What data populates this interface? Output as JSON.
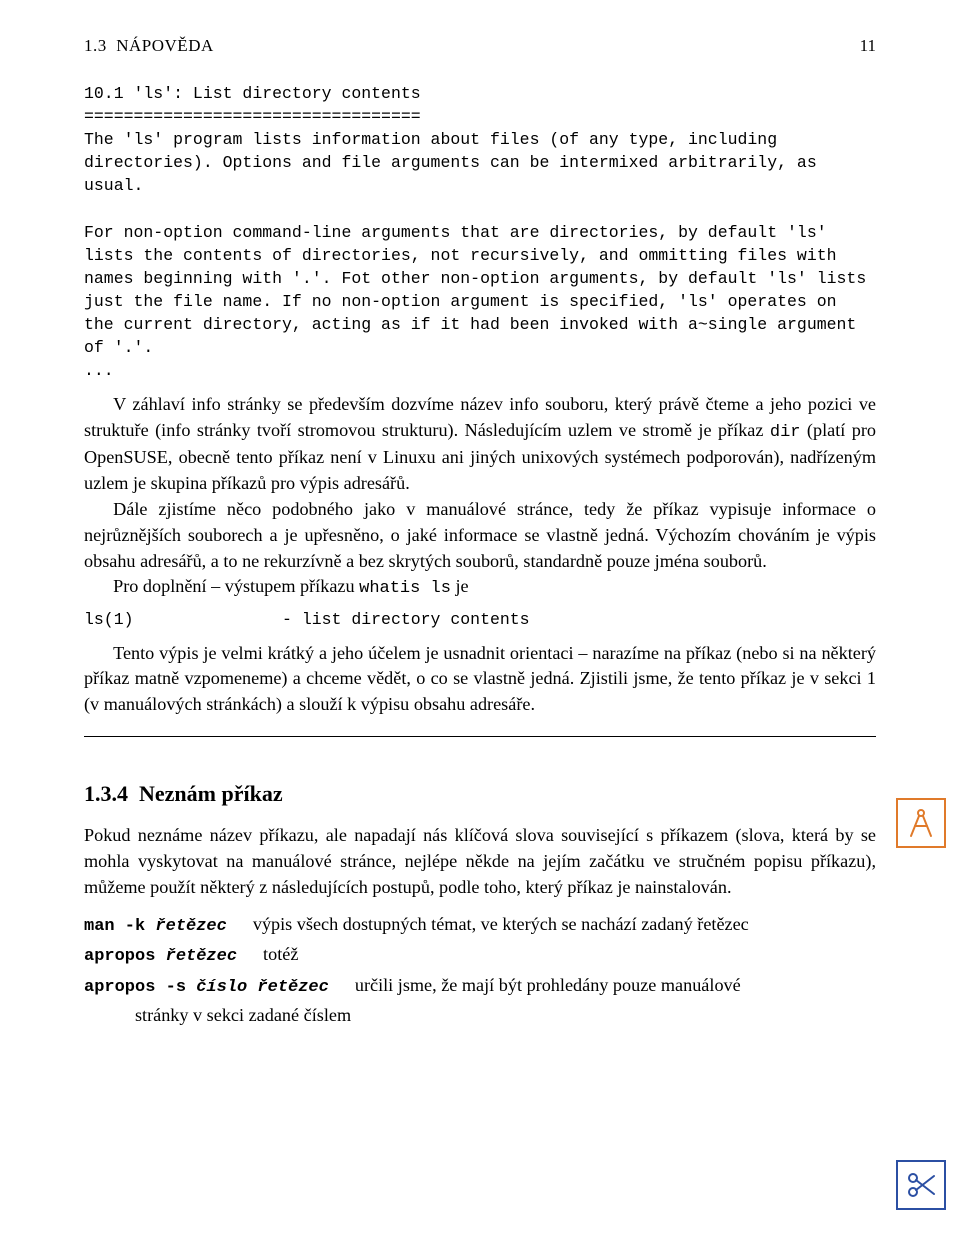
{
  "header": {
    "section_number": "1.3",
    "section_title_caps": "NÁPOVĚDA",
    "page_number": "11"
  },
  "mono_block": "10.1 'ls': List directory contents\n==================================\nThe 'ls' program lists information about files (of any type, including directories). Options and file arguments can be intermixed arbitrarily, as usual.\n\nFor non-option command-line arguments that are directories, by default 'ls' lists the contents of directories, not recursively, and ommitting files with names beginning with '.'. Fot other non-option arguments, by default 'ls' lists just the file name. If no non-option argument is specified, 'ls' operates on the current directory, acting as if it had been invoked with a~single argument of '.'.\n...",
  "para1_a": "V záhlaví info stránky se především dozvíme název info souboru, který právě čteme a jeho pozici ve struktuře (info stránky tvoří stromovou strukturu). Následujícím uzlem ve stromě je příkaz ",
  "para1_mono": "dir",
  "para1_b": " (platí pro OpenSUSE, obecně tento příkaz není v Linuxu ani jiných unixových systémech podporován), nadřízeným uzlem je skupina příkazů pro výpis adresářů.",
  "para2": "Dále zjistíme něco podobného jako v manuálové stránce, tedy že příkaz vypisuje informace o nejrůznějších souborech a je upřesněno, o jaké informace se vlastně jedná. Výchozím chováním je výpis obsahu adresářů, a to ne rekurzívně a bez skrytých souborů, standardně pouze jména souborů.",
  "para3_a": "Pro doplnění – výstupem příkazu ",
  "para3_mono": "whatis ls",
  "para3_b": " je",
  "whatis_line": "ls(1)               - list directory contents",
  "para4": "Tento výpis je velmi krátký a jeho účelem je usnadnit orientaci – narazíme na příkaz (nebo si na některý příkaz matně vzpomeneme) a chceme vědět, o co se vlastně jedná. Zjistili jsme, že tento příkaz je v sekci 1 (v manuálových stránkách) a slouží k výpisu obsahu adresáře.",
  "subsection": {
    "number": "1.3.4",
    "title": "Neznám příkaz"
  },
  "para5": "Pokud neznáme název příkazu, ale napadají nás klíčová slova související s příkazem (slova, která by se mohla vyskytovat na manuálové stránce, nejlépe někde na jejím začátku ve stručném popisu příkazu), můžeme použít některý z následujících postupů, podle toho, který příkaz je nainstalován.",
  "cmds": {
    "c1_label_a": "man -k ",
    "c1_label_b": "řetězec",
    "c1_desc": "výpis všech dostupných témat, ve kterých se nachází zadaný řetězec",
    "c2_label_a": "apropos ",
    "c2_label_b": "řetězec",
    "c2_desc": "totéž",
    "c3_label_a": "apropos -s ",
    "c3_label_b": "číslo řetězec",
    "c3_desc_a": "určili jsme, že mají být prohledány pouze manuálové",
    "c3_desc_b": "stránky v sekci zadané číslem"
  },
  "icons": {
    "compass": "compass-icon",
    "scissors": "scissors-icon"
  }
}
